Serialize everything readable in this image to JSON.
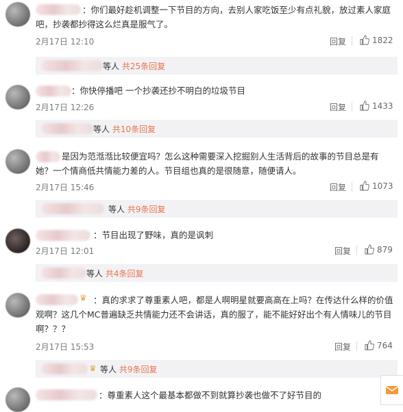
{
  "colors": {
    "link": "#eb7350",
    "meta": "#7c7c7c",
    "subbar_bg": "#f2f2f5"
  },
  "comments": [
    {
      "text": "：你们最好趁机调整一下节目的方向，去别人家吃饭至少有点礼貌，放过素人家庭吧，抄袭都抄得这么烂真是服气了。",
      "date": "2月17日 12:10",
      "reply_label": "回复",
      "likes": "1822",
      "sub": {
        "prefix": "等人",
        "link": "共25条回复"
      }
    },
    {
      "text": "：你快停播吧 一个抄袭还抄不明白的垃圾节目",
      "date": "2月17日 12:26",
      "reply_label": "回复",
      "likes": "1433",
      "sub": {
        "prefix": "等人",
        "link": "共10条回复"
      }
    },
    {
      "text": "是因为范湉湉比较便宜吗？怎么这种需要深入挖掘别人生活背后的故事的节目总是有她？一个情商低共情能力差的人。节目组也真的是很随意，随便请人。",
      "date": "2月17日 15:46",
      "reply_label": "回复",
      "likes": "1073",
      "sub": {
        "prefix": "等人",
        "link": "共9条回复"
      }
    },
    {
      "text": "：节目出现了野味，真的是讽刺",
      "date": "2月17日 12:01",
      "reply_label": "回复",
      "likes": "879",
      "sub": {
        "prefix": "等人",
        "link": "共4条回复"
      }
    },
    {
      "text": "：真的求求了尊重素人吧，都是人啊明星就要高高在上吗？在传达什么样的价值观啊？这几个MC普遍缺乏共情能力还不会讲话，真的服了，能不能好好出个有人情味儿的节目啊？？？",
      "date": "2月17日 15:53",
      "reply_label": "回复",
      "likes": "764",
      "sub": {
        "prefix": "等人",
        "link": "共9条回复"
      }
    },
    {
      "text": "：尊重素人这个最基本都做不到就算抄袭也做不了好节目的"
    }
  ]
}
